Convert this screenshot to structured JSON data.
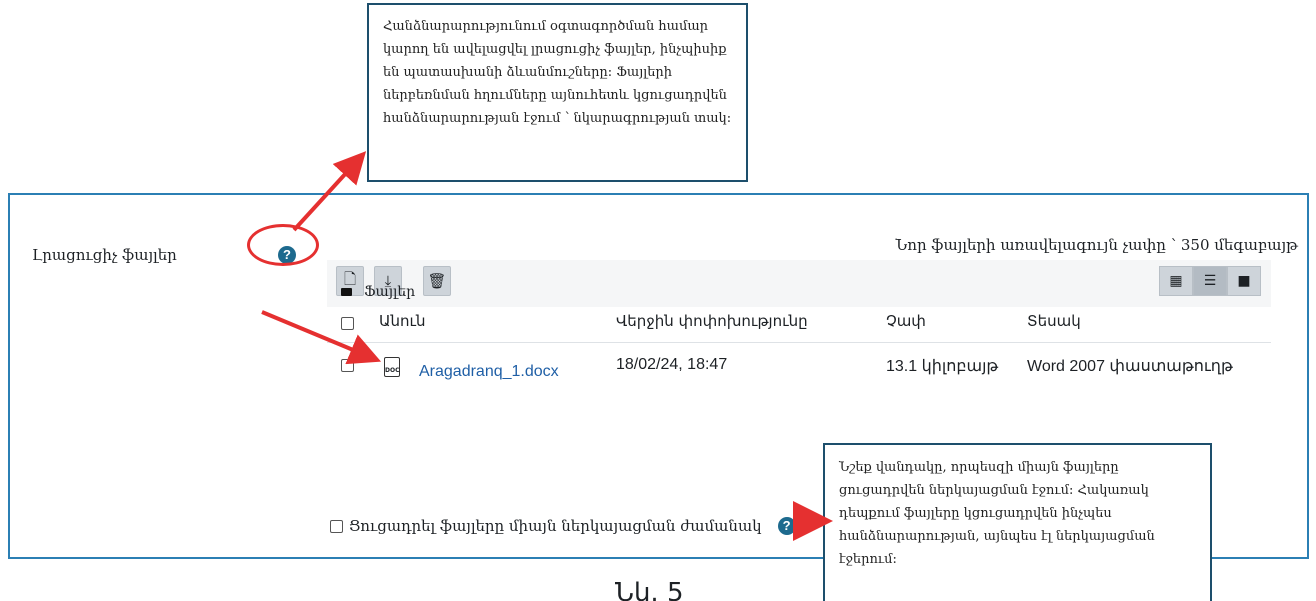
{
  "field": {
    "label": "Լրացուցիչ ֆայլեր",
    "help": "?",
    "max_size": "Նոր ֆայլերի առավելագույն չափը ՝ 350 մեգաբայթ"
  },
  "filemanager": {
    "toolbar": {
      "add": "🗋",
      "download": "⤓",
      "delete": "🗑"
    },
    "views": {
      "icons": "▦",
      "list": "☰",
      "tree": "■"
    },
    "path": {
      "folder_icon": "folder-icon",
      "label": "Ֆայլեր"
    },
    "columns": [
      "Անուն",
      "Վերջին փոփոխությունը",
      "Չափ",
      "Տեսակ"
    ],
    "files": [
      {
        "name": "Aragadranq_1.docx",
        "modified": "18/02/24, 18:47",
        "size": "13.1 կիլոբայթ",
        "type": "Word 2007 փաստաթուղթ",
        "icon_text": "DOC"
      }
    ]
  },
  "show_only_presentation": {
    "label": "Ցուցադրել ֆայլերը միայն ներկայացման ժամանակ",
    "help": "?"
  },
  "callouts": {
    "top": "Հանձնարարությունում օգտագործման համար կարող են ավելացվել լրացուցիչ ֆայլեր, ինչպիսիք են պատասխանի ձևանմուշները: Ֆայլերի ներբեռնման հղումները այնուհետև կցուցադրվեն հանձնարարության էջում ՝ նկարագրության տակ:",
    "bottom": "Նշեք վանդակը, որպեսզի միայն ֆայլերը ցուցադրվեն ներկայացման էջում: Հակառակ դեպքում ֆայլերը կցուցադրվեն ինչպես հանձնարարության, այնպես էլ ներկայացման էջերում:"
  },
  "caption": "Նկ. 5",
  "colors": {
    "frame": "#2b7fb4",
    "arrow": "#e53030",
    "help_icon": "#1d6a8e",
    "link": "#1f5fa6"
  }
}
